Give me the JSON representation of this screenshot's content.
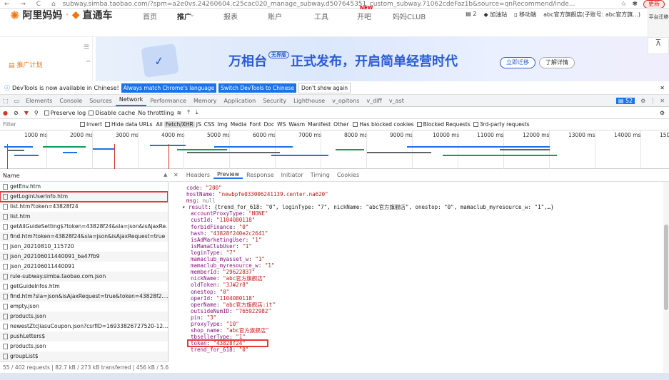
{
  "browser": {
    "url": "subway.simba.taobao.com/?spm=a2e0vs.24260604.c25cac020_manage_subway.d507645351_custom_subway.71062cdeFaz1b&source=qnRecommend/inde...",
    "update_label": "更新"
  },
  "site": {
    "logo": "阿里妈妈",
    "brand": "直通车",
    "nav": [
      "首页",
      "推广",
      "报表",
      "账户",
      "工具",
      "开吧",
      "妈妈CLUB"
    ],
    "new_badge": "NEW",
    "right": [
      "2",
      "加油站",
      "移动端",
      "abc官方旗舰店(子账号: abc官方旗...)"
    ],
    "side_btn": "平台迁移",
    "plan_label": "推广计划"
  },
  "banner": {
    "title_a": "万相台",
    "title_tag": "无界版",
    "title_b": "正式发布，开启简单经营时代",
    "btn1": "立即迁移",
    "btn2": "了解详情"
  },
  "devtools": {
    "info": {
      "text": "DevTools is now available in Chinese!",
      "btn1": "Always match Chrome's language",
      "btn2": "Switch DevTools to Chinese",
      "btn3": "Don't show again"
    },
    "tabs": [
      "Elements",
      "Console",
      "Sources",
      "Network",
      "Performance",
      "Memory",
      "Application",
      "Security",
      "Lighthouse",
      "v_opitons",
      "v_diff",
      "v_ast"
    ],
    "issues": "52",
    "toolbar": {
      "preserve": "Preserve log",
      "cache": "Disable cache",
      "throttle": "No throttling"
    },
    "filter": {
      "placeholder": "Filter",
      "invert": "Invert",
      "hide_data": "Hide data URLs",
      "types": [
        "All",
        "Fetch/XHR",
        "JS",
        "CSS",
        "Img",
        "Media",
        "Font",
        "Doc",
        "WS",
        "Wasm",
        "Manifest",
        "Other"
      ],
      "blocked_cookies": "Has blocked cookies",
      "blocked_req": "Blocked Requests",
      "third": "3rd-party requests"
    },
    "timeline": [
      "1000 ms",
      "2000 ms",
      "3000 ms",
      "4000 ms",
      "5000 ms",
      "6000 ms",
      "7000 ms",
      "8000 ms",
      "9000 ms",
      "10000 ms",
      "11000 ms",
      "12000 ms",
      "13000 ms",
      "14000 ms",
      "150"
    ],
    "list_header": "Name",
    "requests": [
      "getEnv.htm",
      "getLoginUserInfo.htm",
      "list.htm?token=43828f24",
      "list.htm",
      "getAllGuideSetting$?token=43828f24&sla=json&isAjaxRe...",
      "find.htm?token=43828f24&sla=json&isAjaxRequest=true",
      "json_20210810_115720",
      "json_202106011440091_ba47fb9",
      "json_202106011440091",
      "rule-subway.simba.taobao.com.json",
      "getGuideInfos.htm",
      "find.htm?sla=json&isAjaxRequest=true&token=43828f2......",
      "empty.json",
      "products.json",
      "newestZtcJiasuCoupon.json?csrfID=16933826727520-12......",
      "pushLetters$",
      "products.json",
      "groupList$"
    ],
    "status": "55 / 402 requests | 82.7 kB / 273 kB transferred | 456 kB / 5.6 M",
    "detail_tabs": [
      "Headers",
      "Preview",
      "Response",
      "Initiator",
      "Timing",
      "Cookies"
    ],
    "preview": {
      "code": "\"200\"",
      "hostName": "\"newbpfe033006241139.center.na620\"",
      "msg": "null",
      "result_summary": "{trend_for_618: \"0\", loginType: \"7\", nickName: \"abc官方旗舰店\", onestop: \"0\", mamaclub_myresource_w: \"1\",…}",
      "fields": [
        [
          "accountProxyType",
          "\"NONE\""
        ],
        [
          "custId",
          "\"1104080118\""
        ],
        [
          "forbidFinance",
          "\"0\""
        ],
        [
          "hash",
          "\"43828f240e2c2641\""
        ],
        [
          "isAdMarketingUser",
          "\"1\""
        ],
        [
          "isMamaClubUser",
          "\"1\""
        ],
        [
          "loginType",
          "\"7\""
        ],
        [
          "mamaclub_myasset_w",
          "\"1\""
        ],
        [
          "mamaclub_myresource_w",
          "\"1\""
        ],
        [
          "memberId",
          "\"29622837\""
        ],
        [
          "nickName",
          "\"abc官方旗舰店\""
        ],
        [
          "oldToken",
          "\"3J#2r8\""
        ],
        [
          "onestop",
          "\"0\""
        ],
        [
          "operId",
          "\"1104080118\""
        ],
        [
          "operName",
          "\"abc官方旗舰店:it\""
        ],
        [
          "outsideNumID",
          "\"765922982\""
        ],
        [
          "pin",
          "\"3\""
        ],
        [
          "proxyType",
          "\"10\""
        ],
        [
          "shop_name",
          "\"abc官方旗舰店\""
        ],
        [
          "tbsellerType",
          "\"1\""
        ],
        [
          "token",
          "\"43828f24\""
        ],
        [
          "trend_for_618",
          "\"0\""
        ]
      ]
    }
  }
}
